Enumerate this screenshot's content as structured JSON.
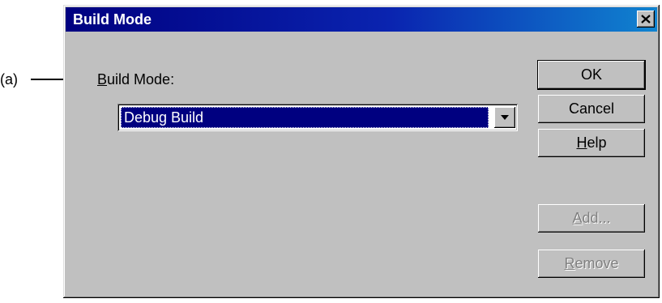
{
  "callout": {
    "label": "(a)"
  },
  "dialog": {
    "title": "Build Mode",
    "close_icon": "close-x-icon",
    "field_label_accel": "B",
    "field_label_rest": "uild Mode:",
    "combo_value": "Debug Build",
    "combo_arrow_icon": "chevron-down-icon"
  },
  "buttons": {
    "ok": "OK",
    "cancel": "Cancel",
    "help_accel": "H",
    "help_rest": "elp",
    "add_accel": "A",
    "add_rest": "dd...",
    "remove_accel": "R",
    "remove_rest": "emove"
  },
  "colors": {
    "title_gradient_start": "#000080",
    "title_gradient_end": "#1084d0",
    "face": "#c0c0c0",
    "selection": "#000080",
    "disabled_text": "#808080"
  }
}
